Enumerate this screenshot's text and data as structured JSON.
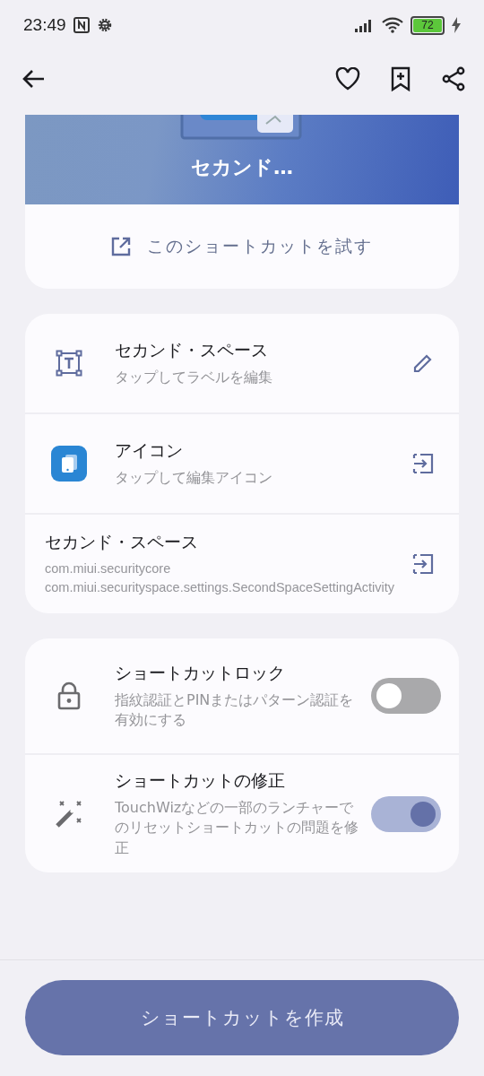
{
  "status_bar": {
    "time": "23:49",
    "battery": "72"
  },
  "banner": {
    "title": "セカンド…"
  },
  "try_button": {
    "label": "このショートカットを試す"
  },
  "info_rows": [
    {
      "kind": "label",
      "title": "セカンド・スペース",
      "subtitle": [
        "タップしてラベルを編集"
      ]
    },
    {
      "kind": "icon",
      "title": "アイコン",
      "subtitle": [
        "タップして編集アイコン"
      ]
    },
    {
      "kind": "activity",
      "title": "セカンド・スペース",
      "subtitle": [
        "com.miui.securitycore",
        "com.miui.securityspace.settings.SecondSpaceSettingActivity"
      ]
    }
  ],
  "toggles": [
    {
      "kind": "lock",
      "title": "ショートカットロック",
      "subtitle": "指紋認証とPINまたはパターン認証を有効にする",
      "on": false
    },
    {
      "kind": "fix",
      "title": "ショートカットの修正",
      "subtitle": "TouchWizなどの一部のランチャーでのリセットショートカットの問題を修正",
      "on": true
    }
  ],
  "create_button": {
    "label": "ショートカットを作成"
  }
}
